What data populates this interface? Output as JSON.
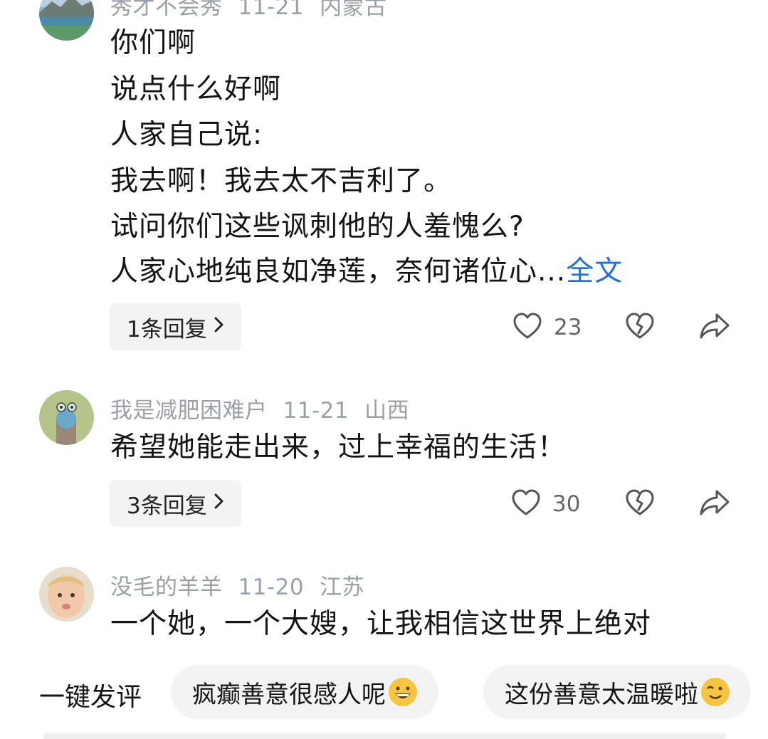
{
  "comments": [
    {
      "username": "秀才不会秀",
      "date": "11-21",
      "location": "内蒙古",
      "lines": [
        "你们啊",
        "说点什么好啊",
        "人家自己说:",
        "我去啊！我去太不吉利了。",
        "试问你们这些讽刺他的人羞愧么?",
        "人家心地纯良如净莲，奈何诸位心..."
      ],
      "expand_label": "全文",
      "reply_label": "1条回复",
      "likes": "23"
    },
    {
      "username": "我是减肥困难户",
      "date": "11-21",
      "location": "山西",
      "lines": [
        "希望她能走出来，过上幸福的生活！"
      ],
      "reply_label": "3条回复",
      "likes": "30"
    },
    {
      "username": "没毛的羊羊",
      "date": "11-20",
      "location": "江苏",
      "lines": [
        "一个她，一个大嫂，让我相信这世界上绝对"
      ]
    }
  ],
  "quick_comment": {
    "label": "一键发评",
    "options": [
      "疯癫善意很感人呢",
      "这份善意太温暖啦"
    ]
  },
  "icons": {
    "like": "heart-icon",
    "dislike": "broken-heart-icon",
    "share": "share-arrow-icon",
    "chevron": "chevron-right-icon"
  },
  "colors": {
    "link": "#1f6fd8",
    "meta": "#9aa0a6",
    "pill_bg": "#f3f3f3"
  }
}
